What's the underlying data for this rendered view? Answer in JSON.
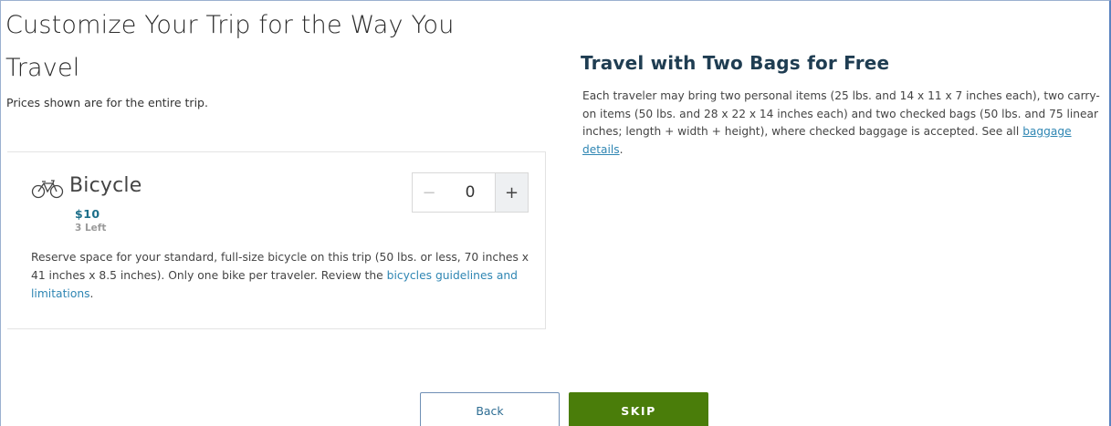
{
  "page": {
    "title": "Customize Your Trip for the Way You Travel",
    "subtitle": "Prices shown are for the entire trip."
  },
  "addon": {
    "name": "Bicycle",
    "icon": "bicycle-icon",
    "price": "$10",
    "remaining": "3 Left",
    "quantity": "0",
    "minus_label": "−",
    "plus_label": "+",
    "description_prefix": "Reserve space for your standard, full-size bicycle on this trip (50 lbs. or less, 70 inches x 41 inches x 8.5 inches). Only one bike per traveler. Review the ",
    "description_link": "bicycles guidelines and limitations",
    "description_suffix": "."
  },
  "bags": {
    "title": "Travel with Two Bags for Free",
    "text_prefix": "Each traveler may bring two personal items (25 lbs. and 14 x 11 x 7 inches each), two carry-on items (50 lbs. and 28 x 22 x 14 inches each) and two checked bags (50 lbs. and 75 linear inches; length + width + height), where checked baggage is accepted. See all ",
    "link_label": "baggage details",
    "text_suffix": "."
  },
  "actions": {
    "back_label": "Back",
    "skip_label": "SKIP"
  },
  "colors": {
    "accent_teal": "#1d6f8a",
    "link_blue": "#2f86b3",
    "skip_green": "#4a7d0a",
    "heading_navy": "#1f3d52"
  }
}
